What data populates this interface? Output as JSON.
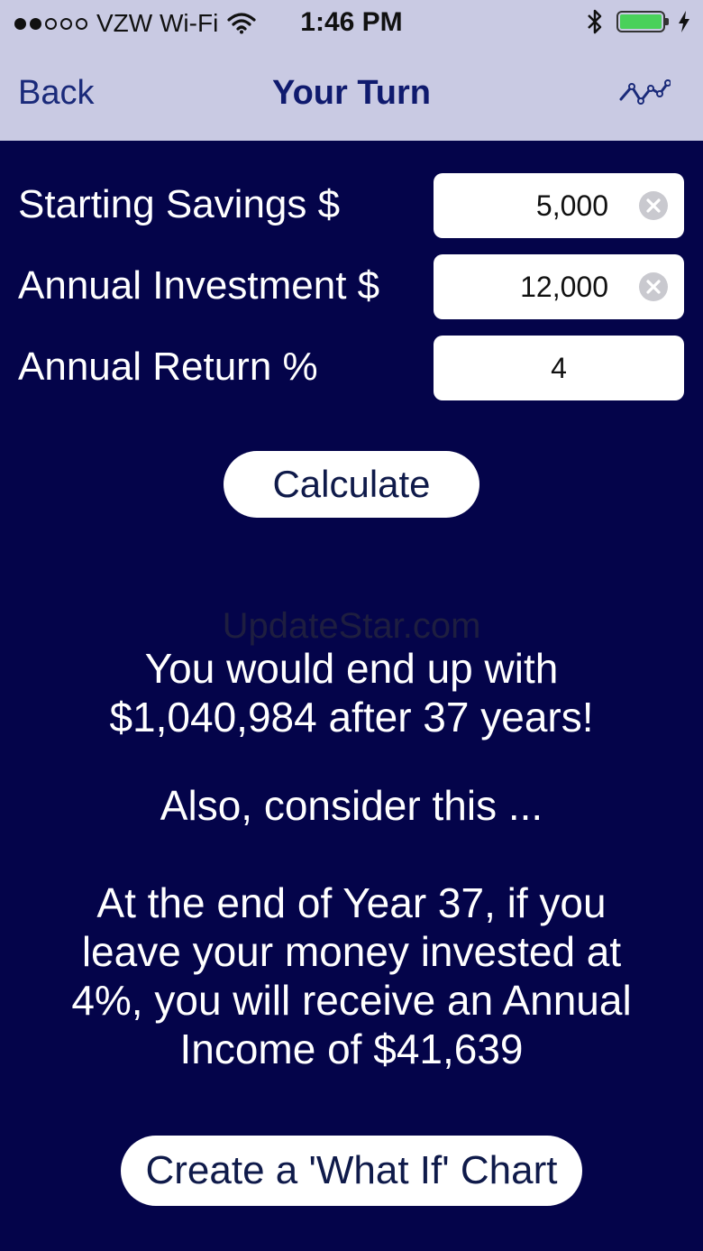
{
  "status_bar": {
    "carrier": "VZW Wi-Fi",
    "time": "1:46 PM"
  },
  "nav": {
    "back_label": "Back",
    "title": "Your Turn",
    "chart_icon": "line-chart-icon"
  },
  "form": {
    "starting_savings": {
      "label": "Starting Savings $",
      "value": "5,000"
    },
    "annual_investment": {
      "label": "Annual Investment $",
      "value": "12,000"
    },
    "annual_return": {
      "label": "Annual Return %",
      "value": "4"
    }
  },
  "calculate_label": "Calculate",
  "watermark": "UpdateStar.com",
  "result": {
    "line1": "You would end up with",
    "line2": "$1,040,984 after 37 years!"
  },
  "consider": "Also, consider this ...",
  "income": {
    "line1": "At the end of Year 37, if you",
    "line2": "leave your money invested at",
    "line3": "4%, you will receive an Annual",
    "line4": "Income of $41,639"
  },
  "what_if_label": "Create a 'What If' Chart",
  "colors": {
    "background": "#04044a",
    "nav_bar": "#c9cae3",
    "nav_text": "#0f1a6e",
    "battery": "#49d15a"
  }
}
